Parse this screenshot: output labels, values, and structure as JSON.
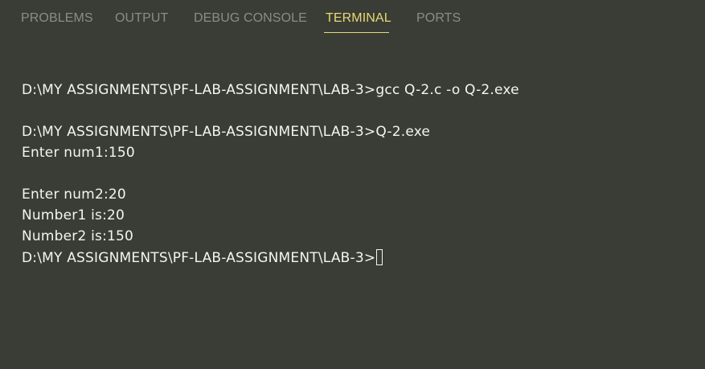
{
  "tabs": [
    {
      "label": "PROBLEMS",
      "active": false
    },
    {
      "label": "OUTPUT",
      "active": false
    },
    {
      "label": "DEBUG CONSOLE",
      "active": false
    },
    {
      "label": "TERMINAL",
      "active": true
    },
    {
      "label": "PORTS",
      "active": false
    }
  ],
  "terminal": {
    "lines": [
      "D:\\MY ASSIGNMENTS\\PF-LAB-ASSIGNMENT\\LAB-3>gcc Q-2.c -o Q-2.exe",
      "D:\\MY ASSIGNMENTS\\PF-LAB-ASSIGNMENT\\LAB-3>Q-2.exe",
      "Enter num1:150",
      "Enter num2:20",
      "Number1 is:20",
      "Number2 is:150",
      "D:\\MY ASSIGNMENTS\\PF-LAB-ASSIGNMENT\\LAB-3>"
    ]
  },
  "colors": {
    "background": "#3a3c36",
    "active_tab": "#e6db74",
    "inactive_tab": "#8c8c84",
    "terminal_text": "#f5f5f0"
  }
}
